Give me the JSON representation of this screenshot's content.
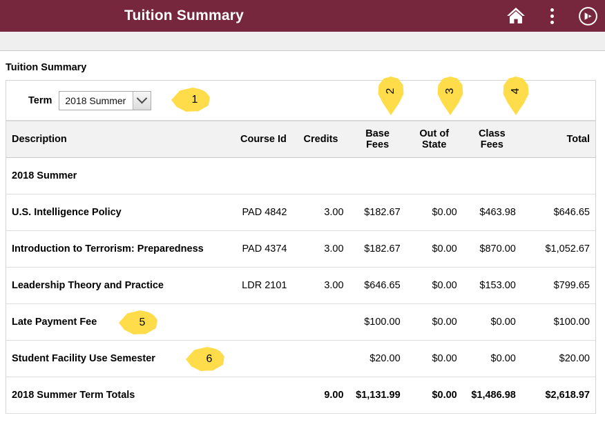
{
  "appbar": {
    "title": "Tuition Summary",
    "icons": [
      {
        "name": "home-icon",
        "glyph": "home"
      },
      {
        "name": "actions-menu-icon",
        "glyph": "kebab"
      },
      {
        "name": "nav-bar-compass-icon",
        "glyph": "compass"
      }
    ],
    "background_color": "#76263d"
  },
  "page": {
    "title": "Tuition Summary"
  },
  "term_filter": {
    "label": "Term",
    "value": "2018 Summer",
    "options": [
      "2018 Summer"
    ]
  },
  "table": {
    "headers": {
      "description": "Description",
      "course_id": "Course Id",
      "credits": "Credits",
      "base_fees": "Base Fees",
      "out_of_state": "Out of State",
      "class_fees": "Class Fees",
      "total": "Total"
    },
    "group_row": {
      "label": "2018 Summer"
    },
    "rows": [
      {
        "description": "U.S. Intelligence Policy",
        "course_id": "PAD 4842",
        "credits": "3.00",
        "base_fees": "$182.67",
        "out_of_state": "$0.00",
        "class_fees": "$463.98",
        "total": "$646.65"
      },
      {
        "description": "Introduction to Terrorism: Preparedness",
        "course_id": "PAD 4374",
        "credits": "3.00",
        "base_fees": "$182.67",
        "out_of_state": "$0.00",
        "class_fees": "$870.00",
        "total": "$1,052.67"
      },
      {
        "description": "Leadership Theory and Practice",
        "course_id": "LDR 2101",
        "credits": "3.00",
        "base_fees": "$646.65",
        "out_of_state": "$0.00",
        "class_fees": "$153.00",
        "total": "$799.65"
      },
      {
        "description": "Late Payment Fee",
        "course_id": "",
        "credits": "",
        "base_fees": "$100.00",
        "out_of_state": "$0.00",
        "class_fees": "$0.00",
        "total": "$100.00"
      },
      {
        "description": "Student Facility Use Semester",
        "course_id": "",
        "credits": "",
        "base_fees": "$20.00",
        "out_of_state": "$0.00",
        "class_fees": "$0.00",
        "total": "$20.00"
      }
    ],
    "totals_row": {
      "description": "2018 Summer Term Totals",
      "course_id": "",
      "credits": "9.00",
      "base_fees": "$1,131.99",
      "out_of_state": "$0.00",
      "class_fees": "$1,486.98",
      "total": "$2,618.97"
    }
  },
  "callouts": {
    "color": "#ffdd4a",
    "items": [
      {
        "number": "1",
        "target": "term-dropdown",
        "direction": "left"
      },
      {
        "number": "2",
        "target": "base-fees-header",
        "direction": "down"
      },
      {
        "number": "3",
        "target": "out-of-state-header",
        "direction": "down"
      },
      {
        "number": "4",
        "target": "class-fees-header",
        "direction": "down"
      },
      {
        "number": "5",
        "target": "late-payment-fee-row",
        "direction": "left"
      },
      {
        "number": "6",
        "target": "student-facility-use-row",
        "direction": "left"
      }
    ]
  }
}
